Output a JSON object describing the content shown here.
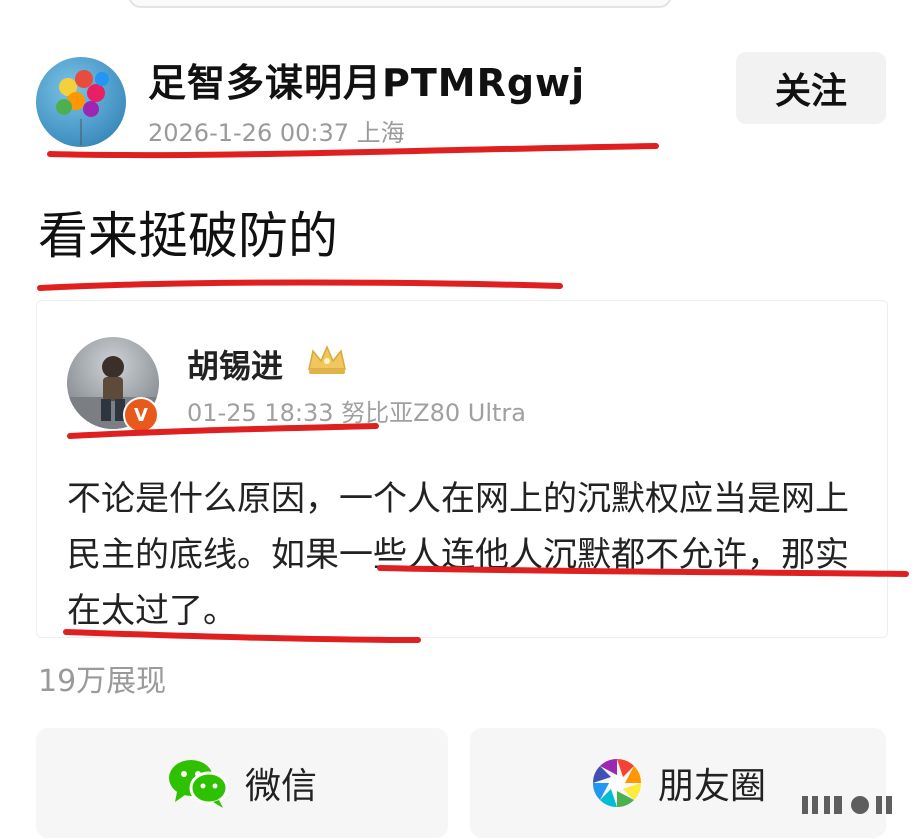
{
  "post": {
    "author": "足智多谋明月PTMRgwj",
    "time_location": "2026-1-26 00:37 上海",
    "follow_label": "关注",
    "text": "看来挺破防的",
    "views": "19万展现"
  },
  "quote": {
    "author": "胡锡进",
    "badge": "V",
    "meta": "01-25 18:33  努比亚Z80 Ultra",
    "body": "不论是什么原因，一个人在网上的沉默权应当是网上民主的底线。如果一些人连他人沉默都不允许，那实在太过了。"
  },
  "share": {
    "wechat_label": "微信",
    "moments_label": "朋友圈"
  },
  "colors": {
    "annotation_red": "#e02020",
    "wechat_green": "#2dc100",
    "secondary_text": "#9a9a9a",
    "badge_orange": "#e85a1c"
  },
  "icons": [
    "balloons-avatar",
    "crown-icon",
    "wechat-icon",
    "moments-icon"
  ]
}
